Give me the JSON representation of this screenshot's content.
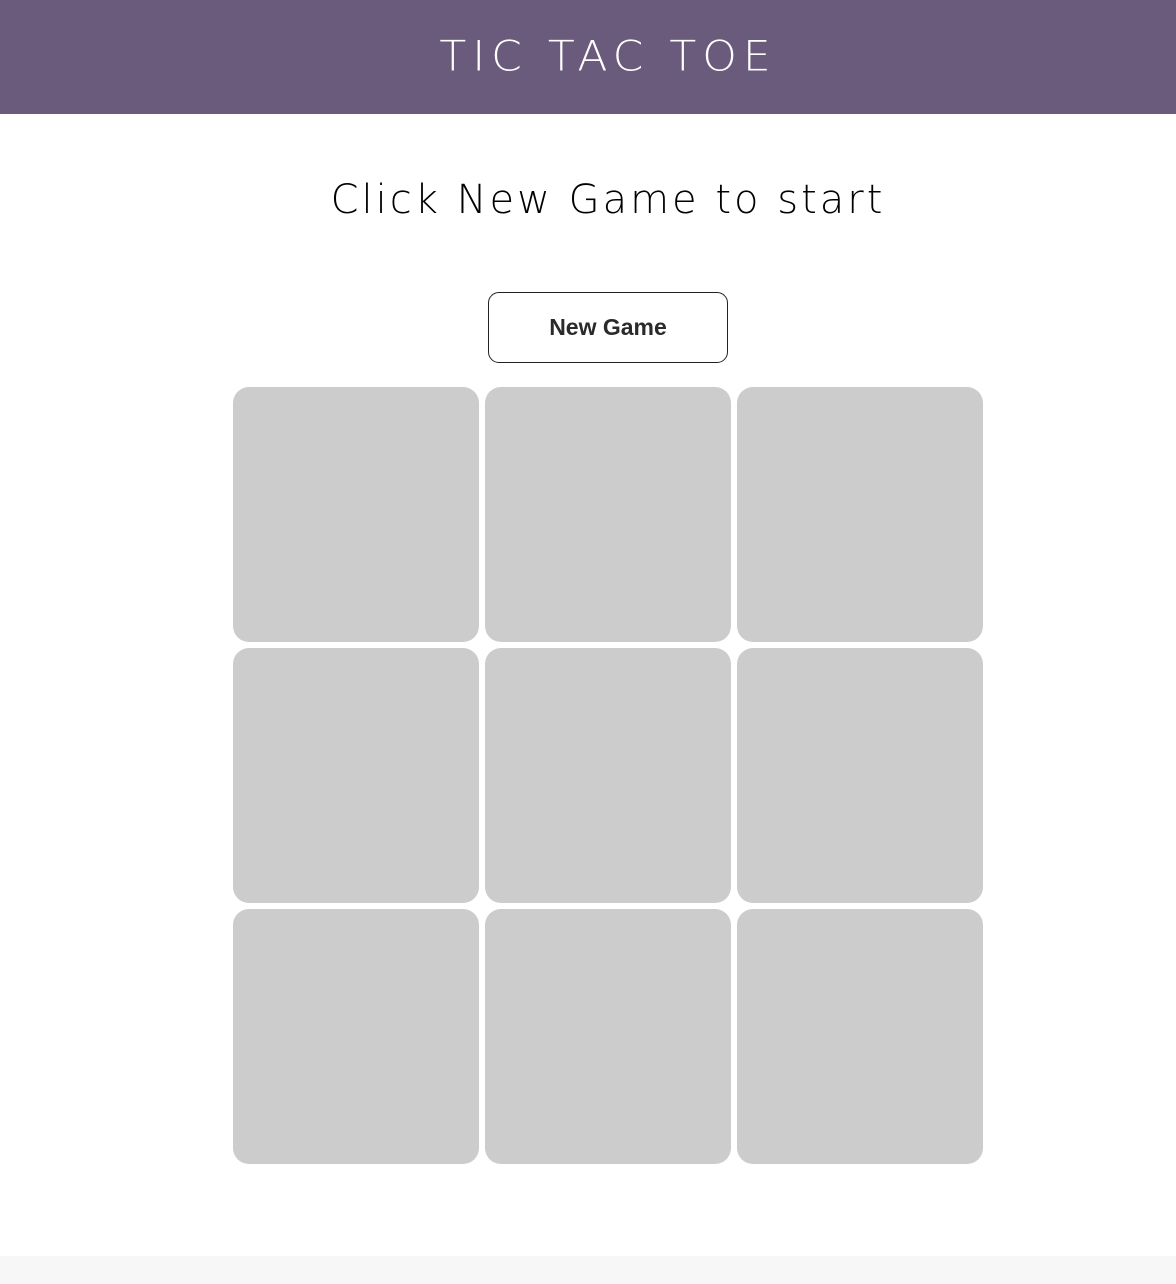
{
  "header": {
    "title": "TIC TAC TOE"
  },
  "status": {
    "message": "Click New Game to start"
  },
  "controls": {
    "new_game_label": "New Game"
  },
  "board": {
    "cells": [
      "",
      "",
      "",
      "",
      "",
      "",
      "",
      "",
      ""
    ]
  },
  "colors": {
    "header_bg": "#6a5a7b",
    "cell_bg": "#cccccc",
    "title_text": "#ffffff"
  }
}
